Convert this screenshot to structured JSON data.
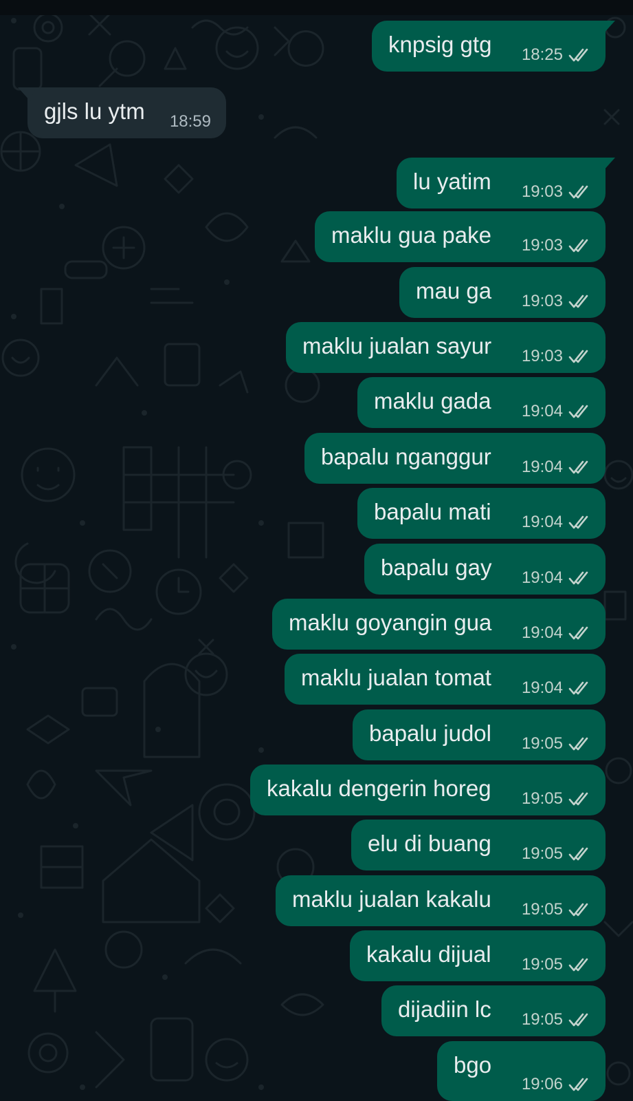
{
  "chat": {
    "messages": [
      {
        "dir": "out",
        "text": "knpsig gtg",
        "time": "18:25"
      },
      {
        "dir": "in",
        "text": "gjls lu ytm",
        "time": "18:59"
      },
      {
        "dir": "out",
        "text": "lu yatim",
        "time": "19:03"
      },
      {
        "dir": "out",
        "text": "maklu gua pake",
        "time": "19:03"
      },
      {
        "dir": "out",
        "text": "mau ga",
        "time": "19:03"
      },
      {
        "dir": "out",
        "text": "maklu jualan sayur",
        "time": "19:03"
      },
      {
        "dir": "out",
        "text": "maklu gada",
        "time": "19:04"
      },
      {
        "dir": "out",
        "text": "bapalu nganggur",
        "time": "19:04"
      },
      {
        "dir": "out",
        "text": "bapalu mati",
        "time": "19:04"
      },
      {
        "dir": "out",
        "text": "bapalu gay",
        "time": "19:04"
      },
      {
        "dir": "out",
        "text": "maklu goyangin gua",
        "time": "19:04"
      },
      {
        "dir": "out",
        "text": "maklu jualan tomat",
        "time": "19:04"
      },
      {
        "dir": "out",
        "text": "bapalu judol",
        "time": "19:05"
      },
      {
        "dir": "out",
        "text": "kakalu dengerin horeg",
        "time": "19:05"
      },
      {
        "dir": "out",
        "text": "elu di buang",
        "time": "19:05"
      },
      {
        "dir": "out",
        "text": "maklu jualan kakalu",
        "time": "19:05"
      },
      {
        "dir": "out",
        "text": "kakalu dijual",
        "time": "19:05"
      },
      {
        "dir": "out",
        "text": "dijadiin lc",
        "time": "19:05"
      },
      {
        "dir": "out",
        "text": "bgo",
        "time": "19:06"
      }
    ]
  },
  "icons": {
    "read_receipt": "double-check-icon",
    "tick_color": "#c3d3cd"
  },
  "colors": {
    "background": "#0b141a",
    "outgoing_bubble": "#005c4b",
    "incoming_bubble": "#1f2c33",
    "text": "#e9edef"
  }
}
